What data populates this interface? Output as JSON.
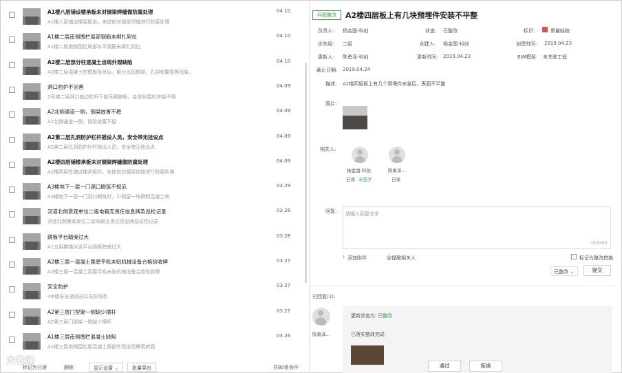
{
  "list": {
    "items": [
      {
        "title": "A1楼八层铺设楼承板未对钢梁焊缝做防腐处理",
        "desc": "A1楼八层铺设楼层板前，未提前对钢梁焊缝进行防腐处理",
        "date": "04.10",
        "bold": true
      },
      {
        "title": "A1楼二层南侧围栏局部钢筋未绑扎到位",
        "desc": "A1楼二层南侧围栏局部水平钢筋未绑扎到位",
        "date": "04.10",
        "bold": false
      },
      {
        "title": "A2楼二层部分柱混凝土出现外观缺陷",
        "desc": "A2楼二层混凝土柱模板拆除后，部分出现蜂窝、孔洞和露筋等现象。",
        "date": "04.10",
        "bold": true
      },
      {
        "title": "洞口防护不完善",
        "desc": "2号楼二层洞口临边栏杆下部无踢脚板，金型化围栏安装不得",
        "date": "04.09",
        "bold": false
      },
      {
        "title": "A2北侧通道一侧，钢梁放置不稳",
        "desc": "A2北侧通道一侧，钢梁放置不稳",
        "date": "04.09",
        "bold": false
      },
      {
        "title": "A2第二层孔洞防护栏杆摇设人员，安全带无挂设点",
        "desc": "A2第二层孔洞防护栏杆摇设人员，安全带无挂设点",
        "date": "04.09",
        "bold": true
      },
      {
        "title": "A2楼四层铺楼承板未对钢梁焊缝做防腐处理",
        "desc": "A2楼四层在铺设楼承板时，未提前对钢梁焊缝进行防腐处理",
        "date": "04.09",
        "bold": true
      },
      {
        "title": "A3楼地下一层一门洞口刷筑不规范",
        "desc": "A3楼地下一层一门洞口刷筑时，少预留一块预制混凝土块",
        "date": "03.29",
        "bold": false
      },
      {
        "title": "河道北侧景观单位二级电箱无责任信息牌及巡检记录",
        "desc": "河道北侧景观单位二级电箱无责任信息牌及巡检记录",
        "date": "03.28",
        "bold": false
      },
      {
        "title": "跳板平台踏度过大",
        "desc": "A1五层楼梯休息平台跳板跨度过大",
        "date": "03.28",
        "bold": false
      },
      {
        "title": "A2楼三层一混凝土泵磨平机未贴机械设备合格验收牌",
        "desc": "A2楼三层一混凝土泵磨平机未贴机械设备合格验收牌",
        "date": "03.27",
        "bold": false
      },
      {
        "title": "安全防护",
        "desc": "4#楼安全通道进口无防滑条",
        "date": "03.27",
        "bold": false
      },
      {
        "title": "A2第三层门型架一侧缺少横杆",
        "desc": "A2第三层门型架一侧缺少横杆",
        "date": "03.27",
        "bold": false
      },
      {
        "title": "A1楼三层南侧围栏混凝土缺陷",
        "desc": "A1楼三层南侧围栏层混凝土局部外观出现蜂窝麻面",
        "date": "03.26",
        "bold": false
      }
    ],
    "footer": {
      "mark_read": "标记为已读",
      "delete": "删除",
      "display_settings": "显示设置",
      "batch_export": "批量导出",
      "total": "共80条协作"
    }
  },
  "detail": {
    "status_tag": "问题整改",
    "title": "A2楼四层板上有几块预埋件安装不平整",
    "fields": {
      "owner_label": "负责人:",
      "owner": "杨金国-科创",
      "status_label": "状态:",
      "status": "已整改",
      "tag_label": "标识:",
      "tag": "质量缺陷",
      "priority_label": "优先级:",
      "priority": "二级",
      "creator_label": "创建人:",
      "creator": "杨金国-科创",
      "created_label": "创建时间:",
      "created": "2019.04.23",
      "updater_label": "更新人:",
      "updater": "陈勇泽-科创",
      "updated_label": "更新时间:",
      "updated": "2019.04.23",
      "bim_label": "BIM模型:",
      "bim": "未关联工程",
      "deadline_label": "截止日期:",
      "deadline": "2019.04.24",
      "desc_label": "描述:",
      "desc": "A2楼四层板上有几个预埋件安装后，表面不平整",
      "photo_label": "照片:",
      "related_label": "相关人:",
      "reply_label": "回复:"
    },
    "people": [
      {
        "name": "杨金国-科创",
        "read": "已读",
        "extra": "未签字"
      },
      {
        "name": "陈勇泽...",
        "read": "已读",
        "extra": ""
      }
    ],
    "reply": {
      "placeholder": "请输入回复文字",
      "count": "(0/500)",
      "attach": "添加附件",
      "mention": "@提醒相关人",
      "mark_checkbox": "标记为整改措施",
      "status_select": "已整改",
      "submit": "提交"
    },
    "replied": {
      "label": "已回复(1):",
      "user": "陈勇泽...",
      "status_prefix": "更新状态为:",
      "status_value": "已整改",
      "text": "已落实整改完成"
    },
    "actions": {
      "approve": "通过",
      "reject": "拒绝"
    }
  },
  "watermark": "大敬建"
}
